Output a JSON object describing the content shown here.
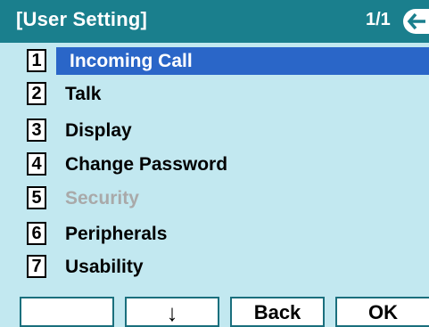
{
  "titlebar": {
    "title": "[User Setting]",
    "page": "1/1",
    "back_icon": "back-arrow-icon"
  },
  "menu": {
    "items": [
      {
        "num": "1",
        "label": "Incoming Call",
        "selected": true,
        "enabled": true
      },
      {
        "num": "2",
        "label": "Talk",
        "selected": false,
        "enabled": true
      },
      {
        "num": "3",
        "label": "Display",
        "selected": false,
        "enabled": true
      },
      {
        "num": "4",
        "label": "Change Password",
        "selected": false,
        "enabled": true
      },
      {
        "num": "5",
        "label": "Security",
        "selected": false,
        "enabled": false
      },
      {
        "num": "6",
        "label": "Peripherals",
        "selected": false,
        "enabled": true
      },
      {
        "num": "7",
        "label": "Usability",
        "selected": false,
        "enabled": true
      }
    ]
  },
  "softkeys": {
    "key1": "",
    "key2": "↓",
    "key3": "Back",
    "key4": "OK"
  },
  "colors": {
    "titlebar": "#1a7f8d",
    "content_bg": "#c2e8f0",
    "selection": "#2a66c8",
    "disabled_text": "#a9a9a9"
  }
}
